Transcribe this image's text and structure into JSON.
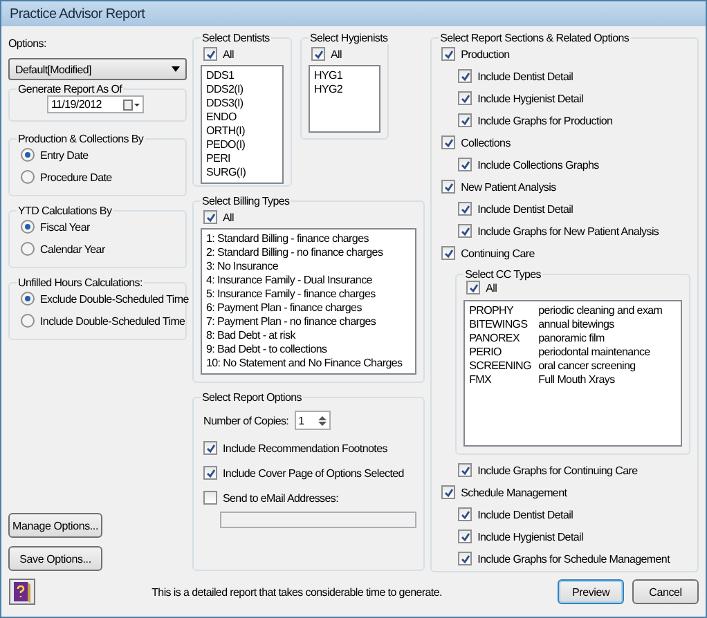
{
  "window": {
    "title": "Practice Advisor Report"
  },
  "options": {
    "label": "Options:",
    "value": "Default[Modified]"
  },
  "report_date": {
    "title": "Generate Report As Of",
    "value": "11/19/2012"
  },
  "radio_groups": [
    {
      "title": "Production & Collections By",
      "options": [
        {
          "label": "Entry Date",
          "selected": true
        },
        {
          "label": "Procedure Date",
          "selected": false
        }
      ]
    },
    {
      "title": "YTD Calculations By",
      "options": [
        {
          "label": "Fiscal Year",
          "selected": true
        },
        {
          "label": "Calendar Year",
          "selected": false
        }
      ]
    },
    {
      "title": "Unfilled Hours Calculations:",
      "options": [
        {
          "label": "Exclude Double-Scheduled Time",
          "selected": true
        },
        {
          "label": "Include Double-Scheduled Time",
          "selected": false
        }
      ]
    }
  ],
  "left_buttons": [
    "Manage Options...",
    "Save Options..."
  ],
  "dentists": {
    "title": "Select Dentists",
    "all": {
      "label": "All",
      "checked": true
    },
    "items": [
      "DDS1",
      "DDS2(I)",
      "DDS3(I)",
      "ENDO",
      "ORTH(I)",
      "PEDO(I)",
      "PERI",
      "SURG(I)"
    ]
  },
  "hygienists": {
    "title": "Select Hygienists",
    "all": {
      "label": "All",
      "checked": true
    },
    "items": [
      "HYG1",
      "HYG2"
    ]
  },
  "billing_types": {
    "title": "Select Billing Types",
    "all": {
      "label": "All",
      "checked": true
    },
    "items": [
      "1: Standard Billing - finance charges",
      "2: Standard Billing - no finance charges",
      "3: No Insurance",
      "4: Insurance Family - Dual Insurance",
      "5: Insurance Family - finance charges",
      "6: Payment Plan - finance charges",
      "7: Payment Plan - no finance charges",
      "8: Bad Debt - at risk",
      "9: Bad Debt - to collections",
      "10: No Statement and No Finance Charges"
    ]
  },
  "report_options": {
    "title": "Select Report Options",
    "copies_label": "Number of Copies:",
    "copies_value": "1",
    "checkboxes": [
      {
        "label": "Include Recommendation Footnotes",
        "checked": true
      },
      {
        "label": "Include Cover Page of Options Selected",
        "checked": true
      },
      {
        "label": "Send to eMail Addresses:",
        "checked": false
      }
    ]
  },
  "report_sections": {
    "title": "Select Report Sections & Related Options",
    "sections": [
      {
        "label": "Production",
        "checked": true,
        "children": [
          {
            "label": "Include Dentist Detail",
            "checked": true
          },
          {
            "label": "Include Hygienist Detail",
            "checked": true
          },
          {
            "label": "Include Graphs for Production",
            "checked": true
          }
        ]
      },
      {
        "label": "Collections",
        "checked": true,
        "children": [
          {
            "label": "Include Collections Graphs",
            "checked": true
          }
        ]
      },
      {
        "label": "New Patient Analysis",
        "checked": true,
        "children": [
          {
            "label": "Include Dentist Detail",
            "checked": true
          },
          {
            "label": "Include Graphs for New Patient Analysis",
            "checked": true
          }
        ]
      },
      {
        "label": "Continuing Care",
        "checked": true,
        "cc_types": {
          "title": "Select CC Types",
          "all": {
            "label": "All",
            "checked": true
          },
          "items": [
            {
              "code": "PROPHY",
              "description": "periodic cleaning and exam"
            },
            {
              "code": "BITEWINGS",
              "description": "annual bitewings"
            },
            {
              "code": "PANOREX",
              "description": "panoramic film"
            },
            {
              "code": "PERIO",
              "description": "periodontal maintenance"
            },
            {
              "code": "SCREENING",
              "description": "oral cancer screening"
            },
            {
              "code": "FMX",
              "description": "Full Mouth Xrays"
            }
          ]
        },
        "children": [
          {
            "label": "Include Graphs for Continuing Care",
            "checked": true
          }
        ]
      },
      {
        "label": "Schedule Management",
        "checked": true,
        "children": [
          {
            "label": "Include Dentist Detail",
            "checked": true
          },
          {
            "label": "Include Hygienist Detail",
            "checked": true
          },
          {
            "label": "Include Graphs for Schedule Management",
            "checked": true
          }
        ]
      }
    ]
  },
  "footer": {
    "note": "This is a detailed report that takes considerable time to generate.",
    "buttons": [
      {
        "label": "Preview",
        "focused": true
      },
      {
        "label": "Cancel",
        "focused": false
      }
    ]
  }
}
